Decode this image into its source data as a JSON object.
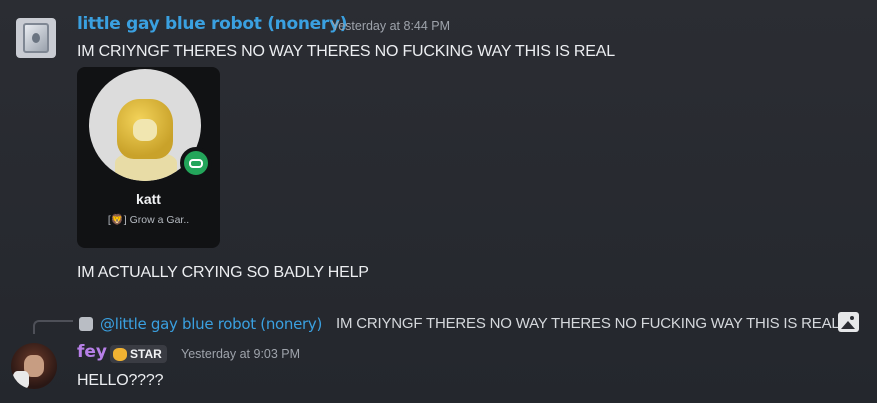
{
  "messages": [
    {
      "author": "little gay blue robot (nonery)",
      "timestamp": "Yesterday at 8:44 PM",
      "text": "IM CRIYNGF THERES NO WAY THERES NO FUCKING WAY THIS IS REAL",
      "embed_card": {
        "name": "katt",
        "subtitle": "[🦁] Grow a Gar..",
        "status_icon": "gamepad-icon"
      },
      "followup_text": "IM ACTUALLY CRYING SO BADLY HELP"
    },
    {
      "reply_to": {
        "mention": "@little gay blue robot (nonery)",
        "text": "IM CRIYNGF THERES NO WAY THERES NO FUCKING WAY THIS IS REAL",
        "attachment_icon": "image-icon"
      },
      "author": "fey",
      "tag": "STAR",
      "timestamp": "Yesterday at 9:03 PM",
      "text": "HELLO????"
    }
  ],
  "colors": {
    "robot_name": "#3aa0e0",
    "fey_name": "#b780e8",
    "status_online": "#23a55a",
    "background": "#2b2d33"
  }
}
